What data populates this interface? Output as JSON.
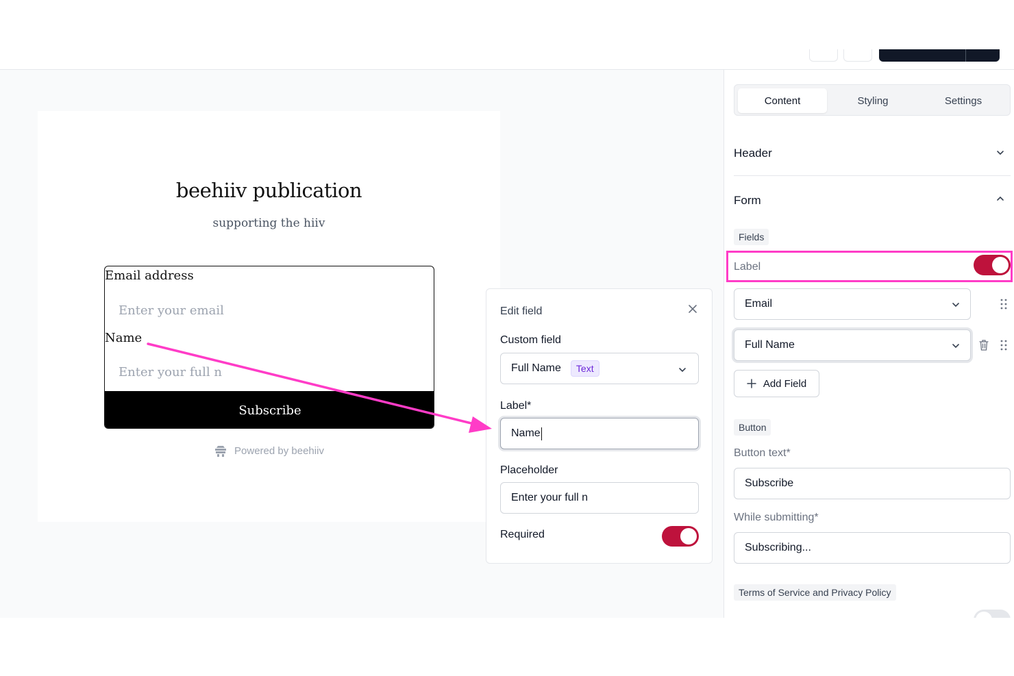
{
  "preview": {
    "title": "beehiiv publication",
    "subtitle": "supporting the hiiv",
    "email_label": "Email address",
    "email_placeholder": "Enter your email",
    "name_label": "Name",
    "name_placeholder": "Enter your full n",
    "subscribe_label": "Subscribe",
    "powered_by": "Powered by beehiiv"
  },
  "edit_field": {
    "title": "Edit field",
    "custom_field_label": "Custom field",
    "custom_field_value": "Full Name",
    "custom_field_type": "Text",
    "label_label": "Label*",
    "label_value": "Name",
    "placeholder_label": "Placeholder",
    "placeholder_value": "Enter your full n",
    "required_label": "Required",
    "required_on": true
  },
  "sidebar": {
    "tabs": [
      {
        "label": "Content",
        "active": true
      },
      {
        "label": "Styling",
        "active": false
      },
      {
        "label": "Settings",
        "active": false
      }
    ],
    "header_section": "Header",
    "form_section": "Form",
    "fields_chip": "Fields",
    "label_toggle_label": "Label",
    "label_toggle_on": true,
    "fields": [
      "Email",
      "Full Name"
    ],
    "add_field_label": "Add Field",
    "button_chip": "Button",
    "button_text_label": "Button text*",
    "button_text_value": "Subscribe",
    "while_submitting_label": "While submitting*",
    "while_submitting_value": "Subscribing...",
    "tos_chip": "Terms of Service and Privacy Policy"
  },
  "colors": {
    "accent_toggle": "#be123c",
    "annotation": "#ff3cc7",
    "badge_text": "#6d28d9"
  }
}
